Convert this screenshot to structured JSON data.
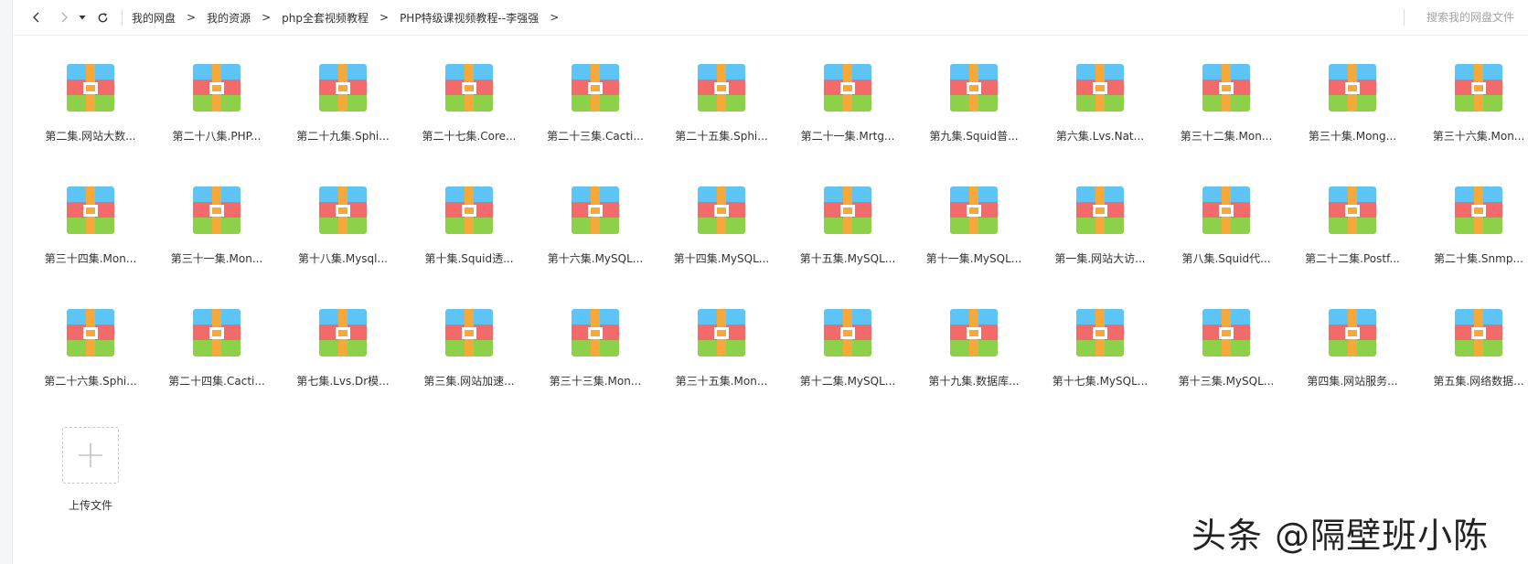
{
  "toolbar": {
    "breadcrumb": [
      "我的网盘",
      "我的资源",
      "php全套视频教程",
      "PHP特级课视频教程--李强强"
    ],
    "crumb_separator": ">",
    "search_placeholder": "搜索我的网盘文件"
  },
  "files": [
    "第二集.网站大数...",
    "第二十八集.PHP...",
    "第二十九集.Sphi...",
    "第二十七集.Core...",
    "第二十三集.Cacti...",
    "第二十五集.Sphi...",
    "第二十一集.Mrtg...",
    "第九集.Squid普...",
    "第六集.Lvs.Nat...",
    "第三十二集.Mon...",
    "第三十集.Mong...",
    "第三十六集.Mon...",
    "第三十四集.Mon...",
    "第三十一集.Mon...",
    "第十八集.Mysql...",
    "第十集.Squid透...",
    "第十六集.MySQL...",
    "第十四集.MySQL...",
    "第十五集.MySQL...",
    "第十一集.MySQL...",
    "第一集.网站大访...",
    "第八集.Squid代...",
    "第二十二集.Postf...",
    "第二十集.Snmp...",
    "第二十六集.Sphi...",
    "第二十四集.Cacti...",
    "第七集.Lvs.Dr模...",
    "第三集.网站加速...",
    "第三十三集.Mon...",
    "第三十五集.Mon...",
    "第十二集.MySQL...",
    "第十九集.数据库...",
    "第十七集.MySQL...",
    "第十三集.MySQL...",
    "第四集.网站服务...",
    "第五集.网络数据..."
  ],
  "upload": {
    "label": "上传文件"
  },
  "watermark": "头条 @隔壁班小陈",
  "colors": {
    "zip_top": "#5ec4f5",
    "zip_middle": "#f26a6a",
    "zip_bottom": "#8dd14a",
    "zip_strap": "#f5a93a"
  },
  "icons": {
    "file": "zip-archive-icon",
    "back": "chevron-left-icon",
    "forward": "chevron-right-icon",
    "dropdown": "caret-down-icon",
    "refresh": "refresh-icon",
    "upload": "plus-icon"
  }
}
